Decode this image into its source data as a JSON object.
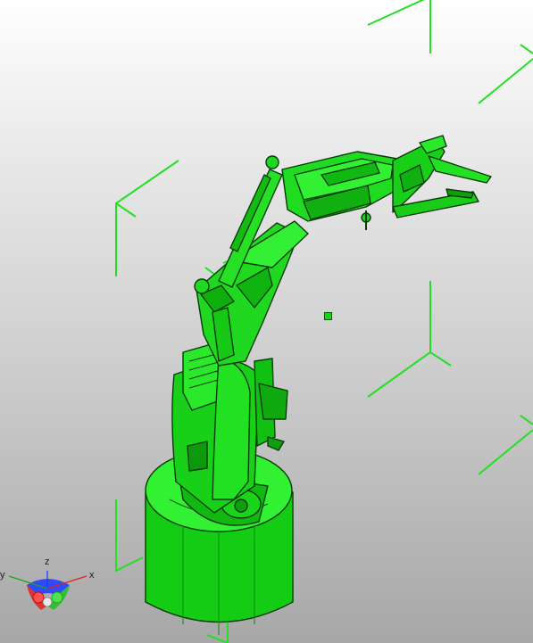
{
  "viewer": {
    "background_top": "#ffffff",
    "background_bottom": "#a7a7a7",
    "model_color": "#14dc14",
    "bounding_box_color": "#22e022"
  },
  "model": {
    "icon": "robot-arm-icon"
  },
  "bounding_box": {
    "icon": "bounding-box-corner-icon"
  },
  "pivot": {
    "icon": "pivot-point-icon"
  },
  "axis_triad": {
    "x_label": "x",
    "y_label": "y",
    "z_label": "z",
    "x_color": "#e02020",
    "y_color": "#20c020",
    "z_color": "#2040ff"
  }
}
